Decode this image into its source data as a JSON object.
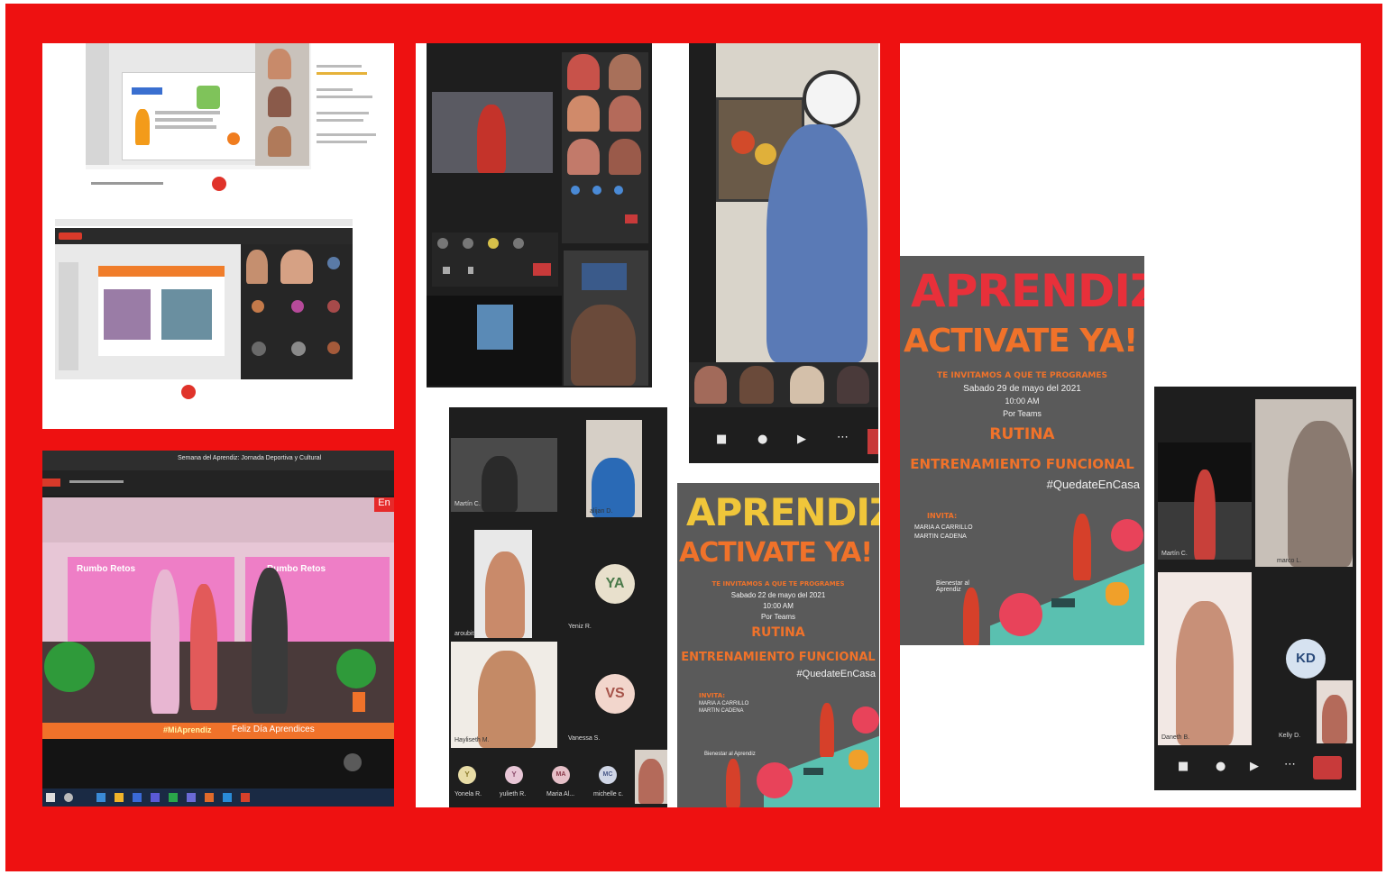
{
  "collage": {
    "colors": {
      "border": "#ee1111",
      "poster_bg": "#5a5a5a",
      "accent_orange": "#f0722a",
      "teams_dark": "#1f1f1f"
    }
  },
  "livestream": {
    "header_title": "Semana del Aprendiz: Jornada Deportiva y Cultural",
    "stage_banner_left": "Rumbo Retos",
    "stage_banner_right": "Rumbo Retos",
    "live_badge": "En",
    "ticker": [
      "#MiAprendiz",
      "Feliz Día Aprendices"
    ]
  },
  "teams_grid": {
    "avatars": [
      {
        "initials": "YA",
        "name": "Yeniz R."
      },
      {
        "initials": "VS",
        "name": "Vanessa S."
      }
    ],
    "bottom_avatars": [
      {
        "initials": "Y",
        "name": "Yonela R."
      },
      {
        "initials": "Y",
        "name": "yulieth R."
      },
      {
        "initials": "MA",
        "name": "Maria Al..."
      },
      {
        "initials": "MC",
        "name": "michelle c."
      }
    ],
    "tile_names": [
      "Martín C.",
      "alijan D.",
      "aroubit..",
      "Yeniz R.",
      "Hayliseth M.",
      "Vanessa S."
    ]
  },
  "poster_small": {
    "title_line1": "APRENDIZ",
    "title_line2": "ACTIVATE YA!",
    "invite": "TE INVITAMOS A QUE TE PROGRAMES",
    "date": "Sabado 22 de mayo del 2021",
    "time": "10:00 AM",
    "via": "Por Teams",
    "routine": "RUTINA",
    "routine_name": "ENTRENAMIENTO FUNCIONAL",
    "hashtag": "#QuedateEnCasa",
    "invita_label": "INVITA:",
    "invita_names": [
      "MARIA A CARRILLO",
      "MARTIN CADENA"
    ],
    "logo_text": "Bienestar al Aprendiz"
  },
  "poster_large": {
    "title_line1": "APRENDIZ",
    "title_line2": "ACTIVATE YA!",
    "invite": "TE INVITAMOS A QUE TE PROGRAMES",
    "date": "Sabado 29 de mayo del 2021",
    "time": "10:00 AM",
    "via": "Por Teams",
    "routine": "RUTINA",
    "routine_name": "ENTRENAMIENTO FUNCIONAL",
    "hashtag": "#QuedateEnCasa",
    "invita_label": "INVITA:",
    "invita_names": [
      "MARIA A CARRILLO",
      "MARTIN CADENA"
    ],
    "logo_text": "Bienestar al Aprendiz"
  },
  "teams_right": {
    "avatar": {
      "initials": "KD",
      "name": "Kelly D."
    },
    "tile_names": [
      "Martín C.",
      "marco L.",
      "Daneth B."
    ]
  },
  "teams_tall": {
    "tile_names": [
      "alijan D.",
      "Hayliseth",
      "Yeniz R.",
      "aroubit",
      "Martín C."
    ]
  }
}
